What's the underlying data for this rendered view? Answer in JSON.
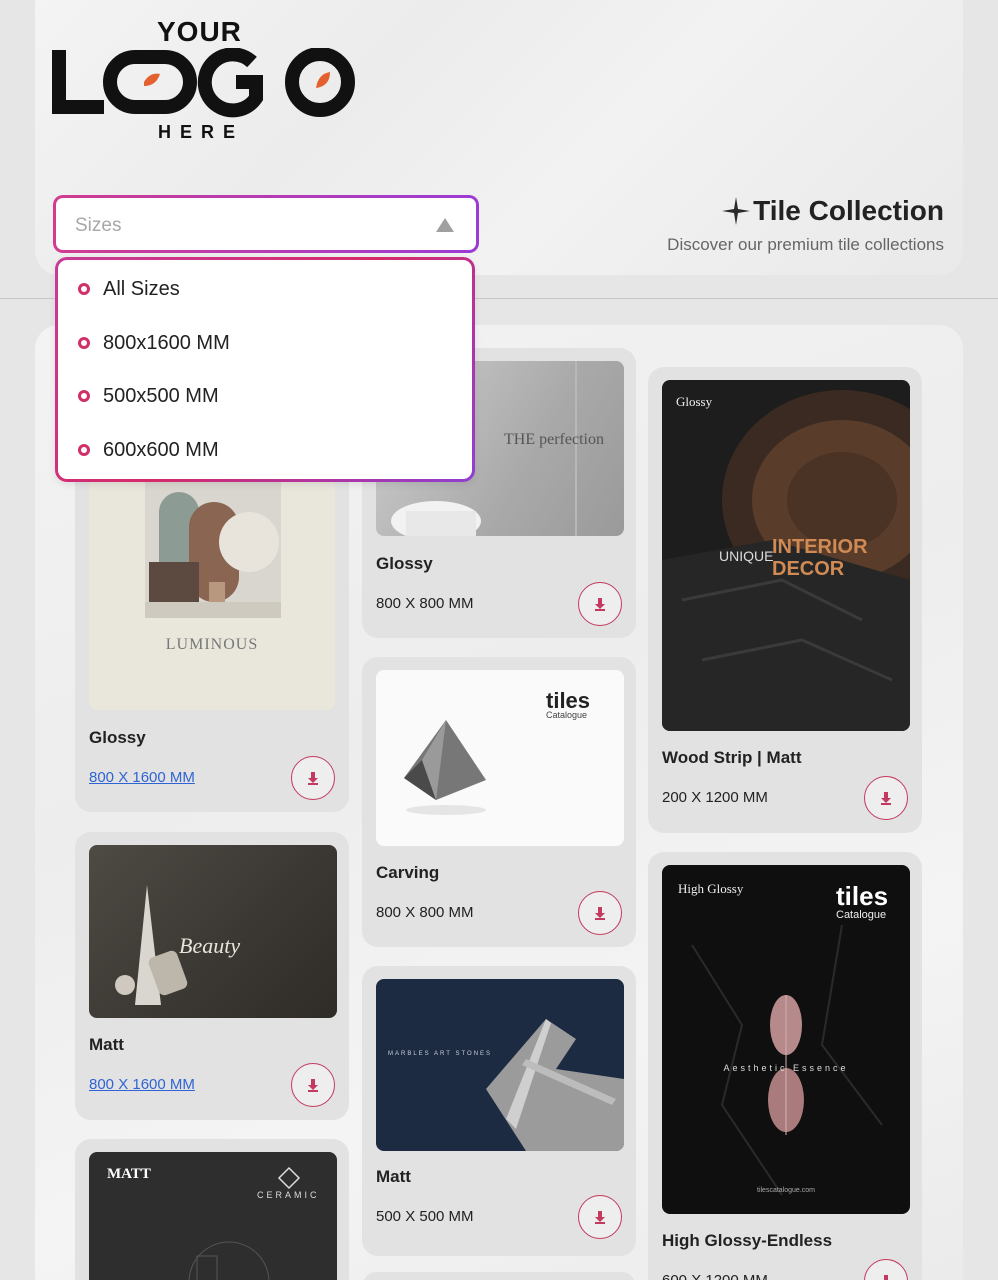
{
  "logo": {
    "top": "YOUR",
    "middle": "LOGO",
    "bottom": "HERE"
  },
  "sizes_select": {
    "placeholder": "Sizes",
    "arrow_icon": "triangle-up-icon"
  },
  "sizes_options": [
    "All Sizes",
    "800x1600 MM",
    "500x500 MM",
    "600x600 MM"
  ],
  "header": {
    "title": "Tile Collection",
    "subtitle": "Discover our premium tile collections",
    "icon": "sparkle-icon"
  },
  "colors": {
    "accent": "#d0306a",
    "link": "#2f64d4",
    "gradient_start": "#d23b8f",
    "gradient_end": "#9b3bd6"
  },
  "tiles": [
    {
      "name": "Glossy",
      "size": "800 X 1600 MM",
      "cover_text": "LUMINOUS"
    },
    {
      "name": "Matt",
      "size": "800 X 1600 MM",
      "cover_text": "Beauty"
    },
    {
      "name": "",
      "size": "",
      "cover_text": "MATT",
      "cover_sub": "CERAMIC"
    },
    {
      "name": "Glossy",
      "size": "800 X 800 MM",
      "cover_text": "THE perfection"
    },
    {
      "name": "Carving",
      "size": "800 X 800 MM",
      "cover_text": "tiles",
      "cover_sub": "Catalogue"
    },
    {
      "name": "Matt",
      "size": "500 X 500 MM",
      "cover_text": "MARBLES ART STONES"
    },
    {
      "name": "Wood Strip | Matt",
      "size": "200 X 1200 MM",
      "cover_text": "INTERIOR DECOR",
      "cover_sub": "UNIQUE",
      "cover_label": "Glossy"
    },
    {
      "name": "High Glossy-Endless",
      "size": "600 X 1200 MM",
      "cover_text": "Aesthetic Essence",
      "cover_sub": "tilescatalogue.com",
      "cover_label": "High Glossy",
      "cover_brand": "tiles",
      "cover_brand_sub": "Catalogue"
    }
  ],
  "download_icon": "download-icon"
}
